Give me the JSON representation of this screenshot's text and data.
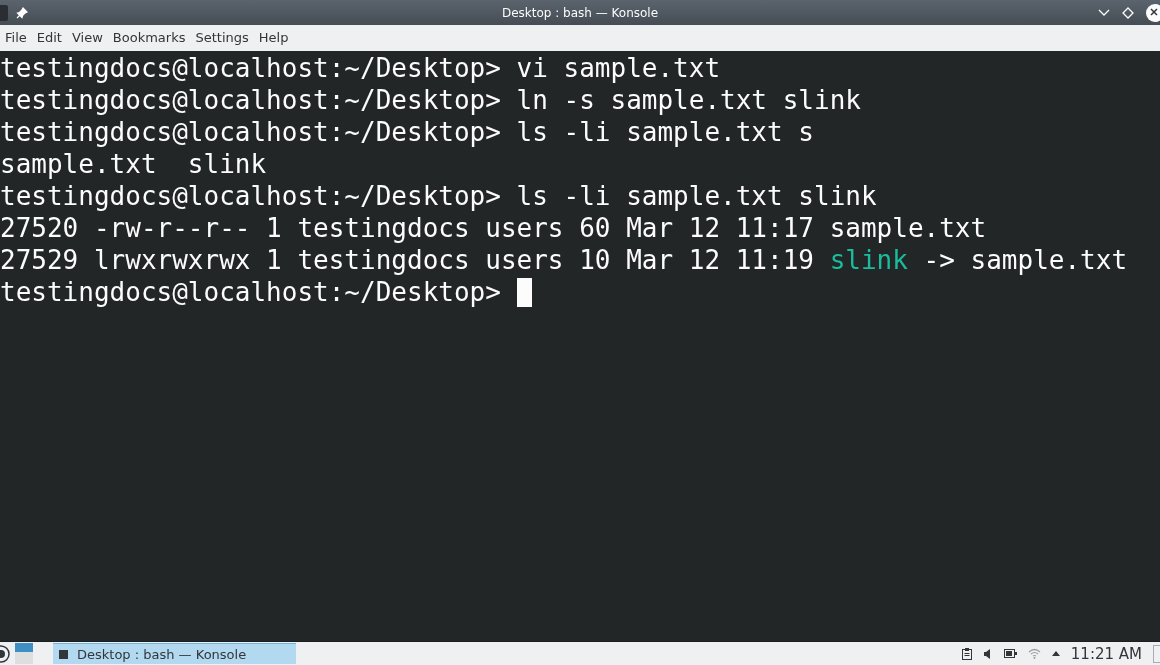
{
  "window": {
    "title": "Desktop : bash — Konsole"
  },
  "menu": [
    "File",
    "Edit",
    "View",
    "Bookmarks",
    "Settings",
    "Help"
  ],
  "terminal": {
    "lines": [
      {
        "segments": [
          {
            "kind": "text",
            "text": "testingdocs@localhost:~/Desktop> vi sample.txt"
          }
        ]
      },
      {
        "segments": [
          {
            "kind": "text",
            "text": "testingdocs@localhost:~/Desktop> ln -s sample.txt slink"
          }
        ]
      },
      {
        "segments": [
          {
            "kind": "text",
            "text": "testingdocs@localhost:~/Desktop> ls -li sample.txt s"
          }
        ]
      },
      {
        "segments": [
          {
            "kind": "text",
            "text": "sample.txt  slink"
          }
        ]
      },
      {
        "segments": [
          {
            "kind": "text",
            "text": "testingdocs@localhost:~/Desktop> ls -li sample.txt slink"
          }
        ]
      },
      {
        "segments": [
          {
            "kind": "text",
            "text": "27520 -rw-r--r-- 1 testingdocs users 60 Mar 12 11:17 sample.txt"
          }
        ]
      },
      {
        "segments": [
          {
            "kind": "text",
            "text": "27529 lrwxrwxrwx 1 testingdocs users 10 Mar 12 11:19 "
          },
          {
            "kind": "symlink",
            "text": "slink"
          },
          {
            "kind": "text",
            "text": " -> sample.txt"
          }
        ]
      },
      {
        "segments": [
          {
            "kind": "text",
            "text": "testingdocs@localhost:~/Desktop> "
          }
        ],
        "cursor": true
      }
    ]
  },
  "taskbar": {
    "tasks": [
      {
        "label": "Desktop : bash — Konsole",
        "selected": true
      }
    ],
    "clock": "11:21 AM"
  }
}
